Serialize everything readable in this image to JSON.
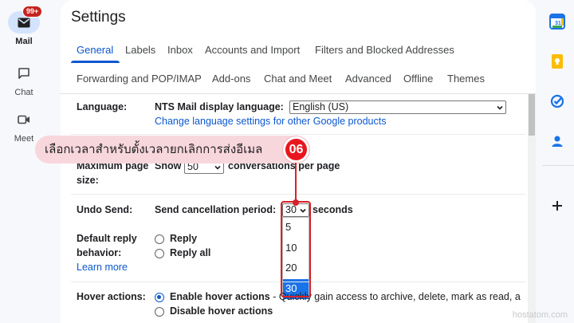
{
  "rail": {
    "mail_label": "Mail",
    "mail_badge": "99+",
    "chat_label": "Chat",
    "meet_label": "Meet"
  },
  "settings": {
    "title": "Settings",
    "tabs": [
      "General",
      "Labels",
      "Inbox",
      "Accounts and Import",
      "Filters and Blocked Addresses",
      "Forwarding and POP/IMAP",
      "Add-ons",
      "Chat and Meet",
      "Advanced",
      "Offline",
      "Themes"
    ],
    "active_tab": "General"
  },
  "language": {
    "label": "Language:",
    "display_label": "NTS Mail display language:",
    "value": "English (US)",
    "link": "Change language settings for other Google products"
  },
  "page_size": {
    "label_line1": "Maximum page",
    "label_line2": "size:",
    "show": "Show",
    "value": "50",
    "suffix": "conversations per page"
  },
  "undo_send": {
    "label": "Undo Send:",
    "period_label": "Send cancellation period:",
    "value": "30",
    "suffix": "seconds",
    "options": [
      "5",
      "10",
      "20",
      "30"
    ],
    "selected": "30"
  },
  "reply": {
    "label_line1": "Default reply",
    "label_line2": "behavior:",
    "learn_more": "Learn more",
    "option_reply": "Reply",
    "option_reply_all": "Reply all"
  },
  "hover": {
    "label": "Hover actions:",
    "enable": "Enable hover actions",
    "enable_desc": "- Quickly gain access to archive, delete, mark as read, a",
    "disable": "Disable hover actions"
  },
  "annotation": {
    "text": "เลือกเวลาสำหรับตั้งเวลายกเลิกการส่งอีเมล",
    "step": "06"
  },
  "watermark": "hostatom.com",
  "colors": {
    "accent": "#0b57d0",
    "annotation_red": "#d92128",
    "callout_bg": "#f8d7dc"
  }
}
